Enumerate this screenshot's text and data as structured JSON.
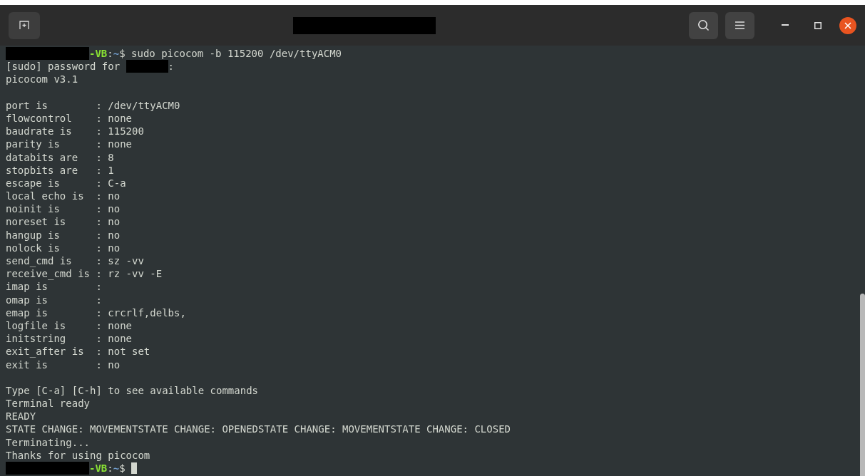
{
  "window": {
    "title_redacted": true
  },
  "lines": [
    {
      "kind": "output",
      "segments": [
        {
          "kind": "mask",
          "wide": true
        },
        {
          "kind": "host",
          "text": "-VB"
        },
        {
          "kind": "plain",
          "text": ":"
        },
        {
          "kind": "path",
          "text": "~"
        },
        {
          "kind": "plain",
          "text": "$ sudo picocom -b 115200 /dev/ttyACM0"
        }
      ]
    },
    {
      "kind": "output",
      "segments": [
        {
          "kind": "plain",
          "text": "[sudo] password for "
        },
        {
          "kind": "mask",
          "wide": false
        },
        {
          "kind": "plain",
          "text": ":"
        }
      ]
    },
    {
      "kind": "output",
      "segments": [
        {
          "kind": "plain",
          "text": "picocom v3.1"
        }
      ]
    },
    {
      "kind": "blank"
    },
    {
      "kind": "output",
      "segments": [
        {
          "kind": "plain",
          "text": "port is        : /dev/ttyACM0"
        }
      ]
    },
    {
      "kind": "output",
      "segments": [
        {
          "kind": "plain",
          "text": "flowcontrol    : none"
        }
      ]
    },
    {
      "kind": "output",
      "segments": [
        {
          "kind": "plain",
          "text": "baudrate is    : 115200"
        }
      ]
    },
    {
      "kind": "output",
      "segments": [
        {
          "kind": "plain",
          "text": "parity is      : none"
        }
      ]
    },
    {
      "kind": "output",
      "segments": [
        {
          "kind": "plain",
          "text": "databits are   : 8"
        }
      ]
    },
    {
      "kind": "output",
      "segments": [
        {
          "kind": "plain",
          "text": "stopbits are   : 1"
        }
      ]
    },
    {
      "kind": "output",
      "segments": [
        {
          "kind": "plain",
          "text": "escape is      : C-a"
        }
      ]
    },
    {
      "kind": "output",
      "segments": [
        {
          "kind": "plain",
          "text": "local echo is  : no"
        }
      ]
    },
    {
      "kind": "output",
      "segments": [
        {
          "kind": "plain",
          "text": "noinit is      : no"
        }
      ]
    },
    {
      "kind": "output",
      "segments": [
        {
          "kind": "plain",
          "text": "noreset is     : no"
        }
      ]
    },
    {
      "kind": "output",
      "segments": [
        {
          "kind": "plain",
          "text": "hangup is      : no"
        }
      ]
    },
    {
      "kind": "output",
      "segments": [
        {
          "kind": "plain",
          "text": "nolock is      : no"
        }
      ]
    },
    {
      "kind": "output",
      "segments": [
        {
          "kind": "plain",
          "text": "send_cmd is    : sz -vv"
        }
      ]
    },
    {
      "kind": "output",
      "segments": [
        {
          "kind": "plain",
          "text": "receive_cmd is : rz -vv -E"
        }
      ]
    },
    {
      "kind": "output",
      "segments": [
        {
          "kind": "plain",
          "text": "imap is        :"
        }
      ]
    },
    {
      "kind": "output",
      "segments": [
        {
          "kind": "plain",
          "text": "omap is        :"
        }
      ]
    },
    {
      "kind": "output",
      "segments": [
        {
          "kind": "plain",
          "text": "emap is        : crcrlf,delbs,"
        }
      ]
    },
    {
      "kind": "output",
      "segments": [
        {
          "kind": "plain",
          "text": "logfile is     : none"
        }
      ]
    },
    {
      "kind": "output",
      "segments": [
        {
          "kind": "plain",
          "text": "initstring     : none"
        }
      ]
    },
    {
      "kind": "output",
      "segments": [
        {
          "kind": "plain",
          "text": "exit_after is  : not set"
        }
      ]
    },
    {
      "kind": "output",
      "segments": [
        {
          "kind": "plain",
          "text": "exit is        : no"
        }
      ]
    },
    {
      "kind": "blank"
    },
    {
      "kind": "output",
      "segments": [
        {
          "kind": "plain",
          "text": "Type [C-a] [C-h] to see available commands"
        }
      ]
    },
    {
      "kind": "output",
      "segments": [
        {
          "kind": "plain",
          "text": "Terminal ready"
        }
      ]
    },
    {
      "kind": "output",
      "segments": [
        {
          "kind": "plain",
          "text": "READY"
        }
      ]
    },
    {
      "kind": "output",
      "segments": [
        {
          "kind": "plain",
          "text": "STATE CHANGE: MOVEMENTSTATE CHANGE: OPENEDSTATE CHANGE: MOVEMENTSTATE CHANGE: CLOSED"
        }
      ]
    },
    {
      "kind": "output",
      "segments": [
        {
          "kind": "plain",
          "text": "Terminating..."
        }
      ]
    },
    {
      "kind": "output",
      "segments": [
        {
          "kind": "plain",
          "text": "Thanks for using picocom"
        }
      ]
    },
    {
      "kind": "output",
      "segments": [
        {
          "kind": "mask",
          "wide": true
        },
        {
          "kind": "host",
          "text": "-VB"
        },
        {
          "kind": "plain",
          "text": ":"
        },
        {
          "kind": "path",
          "text": "~"
        },
        {
          "kind": "plain",
          "text": "$ "
        },
        {
          "kind": "cursor"
        }
      ]
    }
  ]
}
